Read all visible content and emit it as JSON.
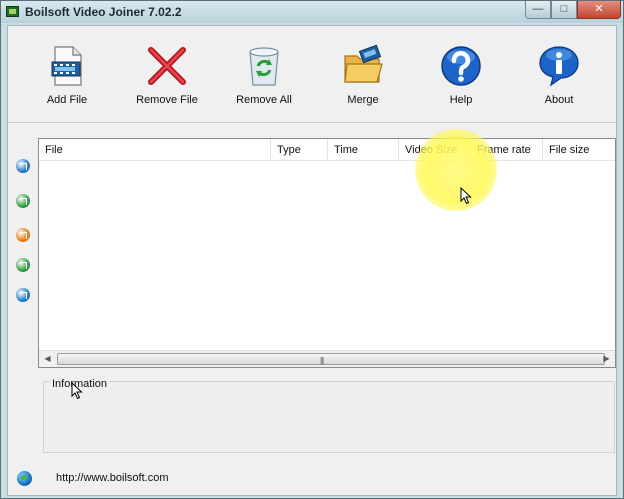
{
  "window": {
    "title": "Boilsoft Video Joiner 7.02.2",
    "controls": {
      "minimize": "—",
      "maximize": "□",
      "close": "✕"
    }
  },
  "toolbar": {
    "items": [
      {
        "label": "Add File",
        "icon": "film-file-icon"
      },
      {
        "label": "Remove File",
        "icon": "red-x-icon"
      },
      {
        "label": "Remove All",
        "icon": "recycle-bin-icon"
      },
      {
        "label": "Merge",
        "icon": "folder-film-icon"
      },
      {
        "label": "Help",
        "icon": "question-icon"
      },
      {
        "label": "About",
        "icon": "info-icon"
      }
    ]
  },
  "side_buttons": [
    {
      "icon": "move-top-icon",
      "color": "#1e78c8"
    },
    {
      "icon": "move-up-icon",
      "color": "#2e9a3a"
    },
    {
      "icon": "play-icon",
      "color": "#e07a10"
    },
    {
      "icon": "move-down-icon",
      "color": "#2e9a3a"
    },
    {
      "icon": "move-bottom-icon",
      "color": "#1e78c8"
    }
  ],
  "file_list": {
    "columns": [
      "File",
      "Type",
      "Time",
      "Video Size",
      "Frame rate",
      "File size"
    ],
    "rows": [],
    "scrollbar_grip": "|||"
  },
  "information": {
    "label": "Information"
  },
  "footer": {
    "url": "http://www.boilsoft.com"
  },
  "colors": {
    "window_frame": "#c9dde3",
    "client_bg": "#f0f0f0",
    "highlight": "#fff850"
  }
}
